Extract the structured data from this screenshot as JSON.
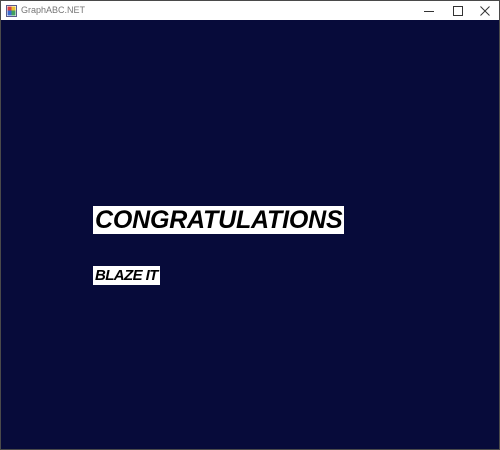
{
  "window": {
    "title": "GraphABC.NET",
    "icon": "graphabc-app-icon",
    "controls": {
      "minimize_icon": "minimize-icon",
      "maximize_icon": "maximize-icon",
      "close_icon": "close-icon"
    }
  },
  "canvas": {
    "background_color": "#070b3a",
    "headline": "CONGRATULATIONS",
    "subtext": "BLAZE IT",
    "text_color": "#000000",
    "label_background": "#ffffff"
  }
}
